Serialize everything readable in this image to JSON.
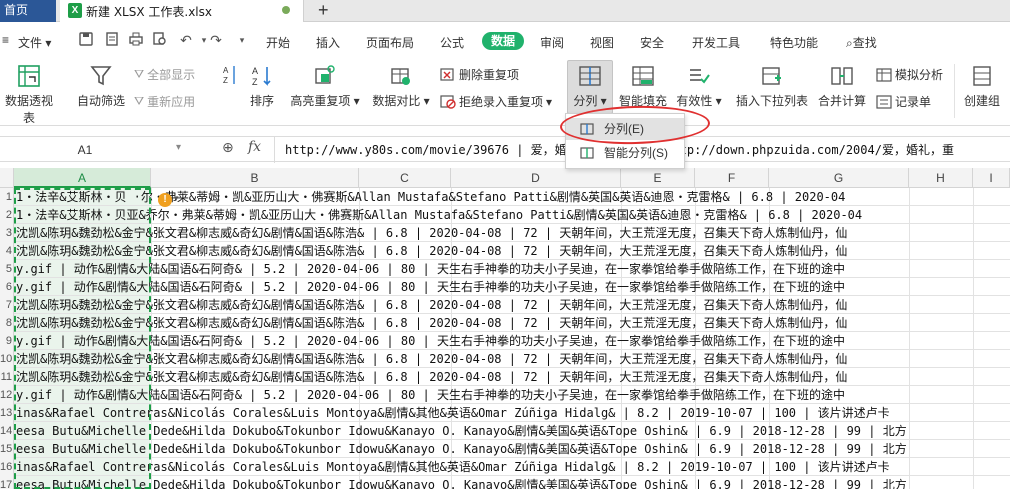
{
  "tabs": {
    "home": "首页",
    "file_name": "新建 XLSX 工作表.xlsx",
    "file_icon": "X",
    "add": "+"
  },
  "menubar": {
    "file": "文件",
    "items": [
      "开始",
      "插入",
      "页面布局",
      "公式",
      "数据",
      "审阅",
      "视图",
      "安全",
      "开发工具",
      "特色功能"
    ],
    "active": "数据",
    "search": "查找"
  },
  "ribbon": {
    "pivot": "数据透视表",
    "autofilter": "自动筛选",
    "show_all": "全部显示",
    "reapply": "重新应用",
    "sort": "排序",
    "highlight_dup": "高亮重复项",
    "compare": "数据对比",
    "remove_dup": "删除重复项",
    "reject_dup": "拒绝录入重复项",
    "split": "分列",
    "smart_fill": "智能填充",
    "validity": "有效性",
    "insert_dropdown": "插入下拉列表",
    "consolidate": "合并计算",
    "simulate": "模拟分析",
    "record": "记录单",
    "create_group": "创建组"
  },
  "dropdown": {
    "items": [
      "分列(E)",
      "智能分列(S)"
    ]
  },
  "formula_bar": {
    "name_box": "A1",
    "fx": "fx",
    "value": "http://www.y80s.com/movie/39676 | 爱，婚礼，婚姻.mp4 | http://down.phpzuida.com/2004/爱，婚礼，重"
  },
  "grid": {
    "columns": [
      "A",
      "B",
      "C",
      "D",
      "E",
      "F",
      "G",
      "H",
      "I"
    ],
    "selected_column": "A",
    "row_numbers": [
      "1",
      "2",
      "3",
      "4",
      "5",
      "6",
      "7",
      "8",
      "9",
      "10",
      "11",
      "12",
      "13",
      "14",
      "15",
      "16",
      "17"
    ],
    "rows": [
      "1・法辛&艾斯林・贝  ·尔・弗莱&蒂姆・凯&亚历山大・佛赛斯&Allan Mustafa&Stefano Patti&剧情&英国&英语&迪恩・克雷格&  | 6.8  | 2020-04",
      "1・法辛&艾斯林・贝亚&乔尔・弗莱&蒂姆・凯&亚历山大・佛赛斯&Allan Mustafa&Stefano Patti&剧情&英国&英语&迪恩・克雷格&  | 6.8  | 2020-04",
      "沈凯&陈玥&魏劲松&金宁&张文君&柳志威&奇幻&剧情&国语&陈浩&  | 6.8  | 2020-04-08  | 72  | 天朝年间，大王荒淫无度，召集天下奇人炼制仙丹，仙",
      "沈凯&陈玥&魏劲松&金宁&张文君&柳志威&奇幻&剧情&国语&陈浩&  | 6.8  | 2020-04-08  | 72  | 天朝年间，大王荒淫无度，召集天下奇人炼制仙丹，仙",
      "y.gif  | 动作&剧情&大陆&国语&石阿奇&  | 5.2  | 2020-04-06  | 80  | 天生右手神拳的功夫小子吴迪，在一家拳馆给拳手做陪练工作，在下班的途中",
      "y.gif  | 动作&剧情&大陆&国语&石阿奇&  | 5.2  | 2020-04-06  | 80  | 天生右手神拳的功夫小子吴迪，在一家拳馆给拳手做陪练工作，在下班的途中",
      "沈凯&陈玥&魏劲松&金宁&张文君&柳志威&奇幻&剧情&国语&陈浩&  | 6.8  | 2020-04-08  | 72  | 天朝年间，大王荒淫无度，召集天下奇人炼制仙丹，仙",
      "沈凯&陈玥&魏劲松&金宁&张文君&柳志威&奇幻&剧情&国语&陈浩&  | 6.8  | 2020-04-08  | 72  | 天朝年间，大王荒淫无度，召集天下奇人炼制仙丹，仙",
      "y.gif  | 动作&剧情&大陆&国语&石阿奇&  | 5.2  | 2020-04-06  | 80  | 天生右手神拳的功夫小子吴迪，在一家拳馆给拳手做陪练工作，在下班的途中",
      "沈凯&陈玥&魏劲松&金宁&张文君&柳志威&奇幻&剧情&国语&陈浩&  | 6.8  | 2020-04-08  | 72  | 天朝年间，大王荒淫无度，召集天下奇人炼制仙丹，仙",
      "沈凯&陈玥&魏劲松&金宁&张文君&柳志威&奇幻&剧情&国语&陈浩&  | 6.8  | 2020-04-08  | 72  | 天朝年间，大王荒淫无度，召集天下奇人炼制仙丹，仙",
      "y.gif  | 动作&剧情&大陆&国语&石阿奇&  | 5.2  | 2020-04-06  | 80  | 天生右手神拳的功夫小子吴迪，在一家拳馆给拳手做陪练工作，在下班的途中",
      "inas&Rafael Contreras&Nicolás Corales&Luis Montoya&剧情&其他&英语&Omar Zúñiga Hidalg&  | 8.2  | 2019-10-07  | 100  | 该片讲述卢卡",
      "eesa Butu&Michelle Dede&Hilda Dokubo&Tokunbor Idowu&Kanayo O. Kanayo&剧情&美国&英语&Tope Oshin&  | 6.9  | 2018-12-28  | 99  | 北方",
      "eesa Butu&Michelle Dede&Hilda Dokubo&Tokunbor Idowu&Kanayo O. Kanayo&剧情&美国&英语&Tope Oshin&  | 6.9  | 2018-12-28  | 99  | 北方",
      "inas&Rafael Contreras&Nicolás Corales&Luis Montoya&剧情&其他&英语&Omar Zúñiga Hidalg&  | 8.2  | 2019-10-07  | 100  | 该片讲述卢卡",
      "eesa Butu&Michelle Dede&Hilda Dokubo&Tokunbor Idowu&Kanayo O. Kanayo&剧情&美国&英语&Tope Oshin&  | 6.9  | 2018-12-28  | 99  | 北方"
    ]
  },
  "colors": {
    "accent_green": "#20b26c",
    "excel_green": "#1e9e48",
    "oval_red": "#e03030",
    "home_tab": "#2b5797"
  }
}
